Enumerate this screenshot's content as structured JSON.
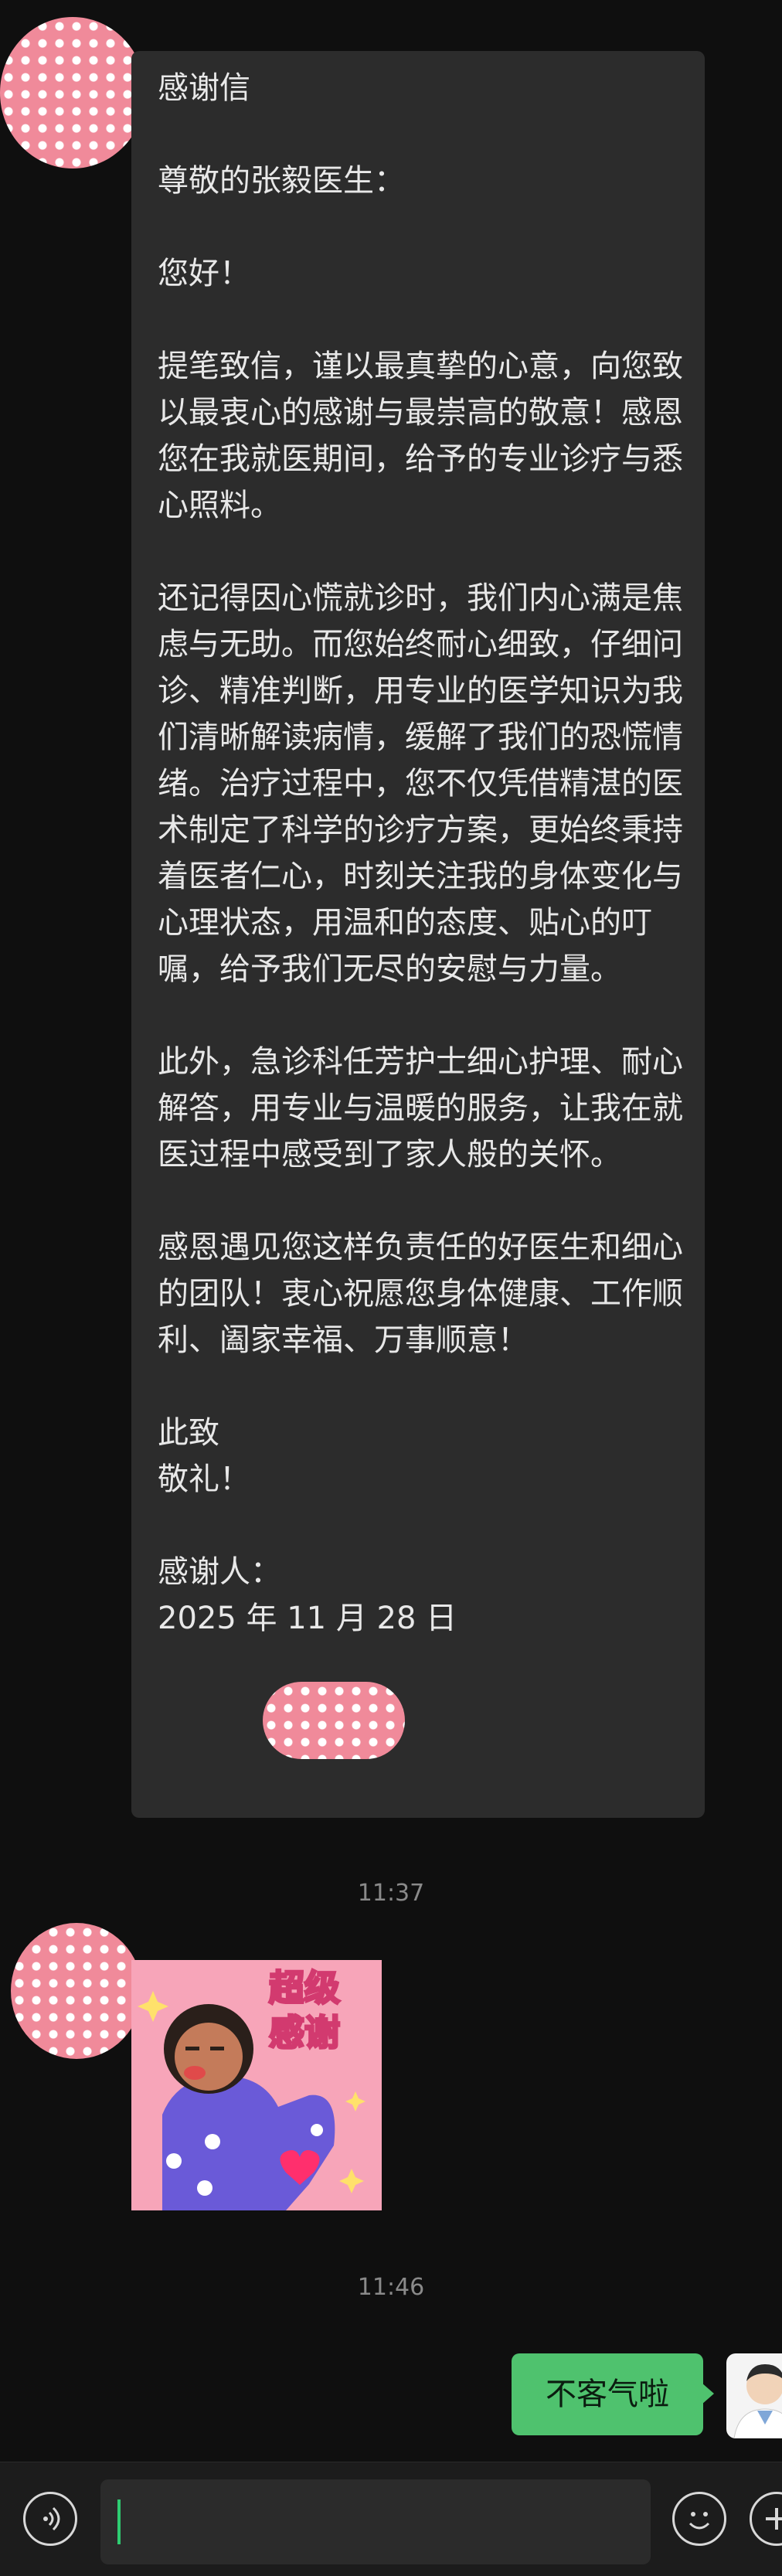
{
  "letter": {
    "title": "感谢信",
    "salutation": "尊敬的张毅医生：",
    "greeting": "您好！",
    "para1": "提笔致信，谨以最真挚的心意，向您致以最衷心的感谢与最崇高的敬意！感恩您在我就医期间，给予的专业诊疗与悉心照料。",
    "para2": "还记得因心慌就诊时，我们内心满是焦虑与无助。而您始终耐心细致，仔细问诊、精准判断，用专业的医学知识为我们清晰解读病情，缓解了我们的恐慌情绪。治疗过程中，您不仅凭借精湛的医术制定了科学的诊疗方案，更始终秉持着医者仁心，时刻关注我的身体变化与心理状态，用温和的态度、贴心的叮嘱，给予我们无尽的安慰与力量。",
    "para3": "此外，急诊科任芳护士细心护理、耐心解答，用专业与温暖的服务，让我在就医过程中感受到了家人般的关怀。",
    "para4": "感恩遇见您这样负责任的好医生和细心的团队！衷心祝愿您身体健康、工作顺利、阖家幸福、万事顺意！",
    "closing1": "此致",
    "closing2": "敬礼！",
    "signature": "感谢人：",
    "date": "2025 年 11 月 28 日"
  },
  "timestamps": [
    "11:37",
    "11:46"
  ],
  "sticker": {
    "text_line1": "超级",
    "text_line2": "感谢"
  },
  "reply": {
    "text": "不客气啦"
  },
  "colors": {
    "background": "#0f0f0f",
    "bubble_in": "#2c2c2c",
    "bubble_out": "#4fc26e",
    "accent_caret": "#2ecc71"
  },
  "icons": [
    "voice-icon",
    "emoji-icon",
    "add-icon"
  ]
}
